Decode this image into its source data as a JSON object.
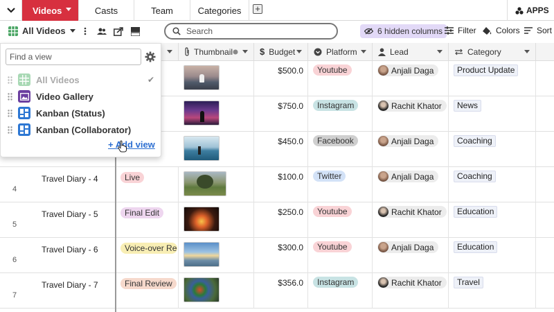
{
  "tabs": {
    "active": "Videos",
    "items": [
      "Casts",
      "Team",
      "Categories"
    ],
    "apps_label": "APPS"
  },
  "toolbar": {
    "view_name": "All Videos",
    "search_placeholder": "Search",
    "hidden_columns": "6 hidden columns",
    "filter": "Filter",
    "colors": "Colors",
    "sort": "Sort"
  },
  "columns": {
    "thumbnail": "Thumbnail",
    "budget": "Budget",
    "platform": "Platform",
    "lead": "Lead",
    "category": "Category"
  },
  "rows": [
    {
      "num": "",
      "title": "",
      "status": "",
      "budget": "$500.0",
      "platform": "Youtube",
      "lead": "Anjali Daga",
      "category": "Product Update"
    },
    {
      "num": "",
      "title": "",
      "status": "",
      "budget": "$750.0",
      "platform": "Instagram",
      "lead": "Rachit Khator",
      "category": "News"
    },
    {
      "num": "",
      "title": "",
      "status": "",
      "budget": "$450.0",
      "platform": "Facebook",
      "lead": "Anjali Daga",
      "category": "Coaching"
    },
    {
      "num": "4",
      "title": "Travel Diary - 4",
      "status": "Live",
      "budget": "$100.0",
      "platform": "Twitter",
      "lead": "Anjali Daga",
      "category": "Coaching"
    },
    {
      "num": "5",
      "title": "Travel Diary - 5",
      "status": "Final Edit",
      "budget": "$250.0",
      "platform": "Youtube",
      "lead": "Rachit Khator",
      "category": "Education"
    },
    {
      "num": "6",
      "title": "Travel Diary - 6",
      "status": "Voice-over Rec",
      "budget": "$300.0",
      "platform": "Youtube",
      "lead": "Anjali Daga",
      "category": "Education"
    },
    {
      "num": "7",
      "title": "Travel Diary - 7",
      "status": "Final Review",
      "budget": "$356.0",
      "platform": "Instagram",
      "lead": "Rachit Khator",
      "category": "Travel"
    }
  ],
  "views_panel": {
    "find_placeholder": "Find a view",
    "items": [
      "All Videos",
      "Video Gallery",
      "Kanban (Status)",
      "Kanban (Collaborator)"
    ],
    "add_view": "+ Add view"
  },
  "colors": {
    "brand_red": "#d7303f",
    "youtube": "#f9d3d6",
    "instagram": "#c8e3e4",
    "facebook": "#cfcfcf",
    "twitter": "#d3e2f7",
    "live": "#f9d3d6",
    "final_edit": "#eed6ef",
    "voice_over": "#f8eeb4",
    "final_review": "#f6d9cc",
    "hidden_columns_bg": "#e2d9f7"
  }
}
